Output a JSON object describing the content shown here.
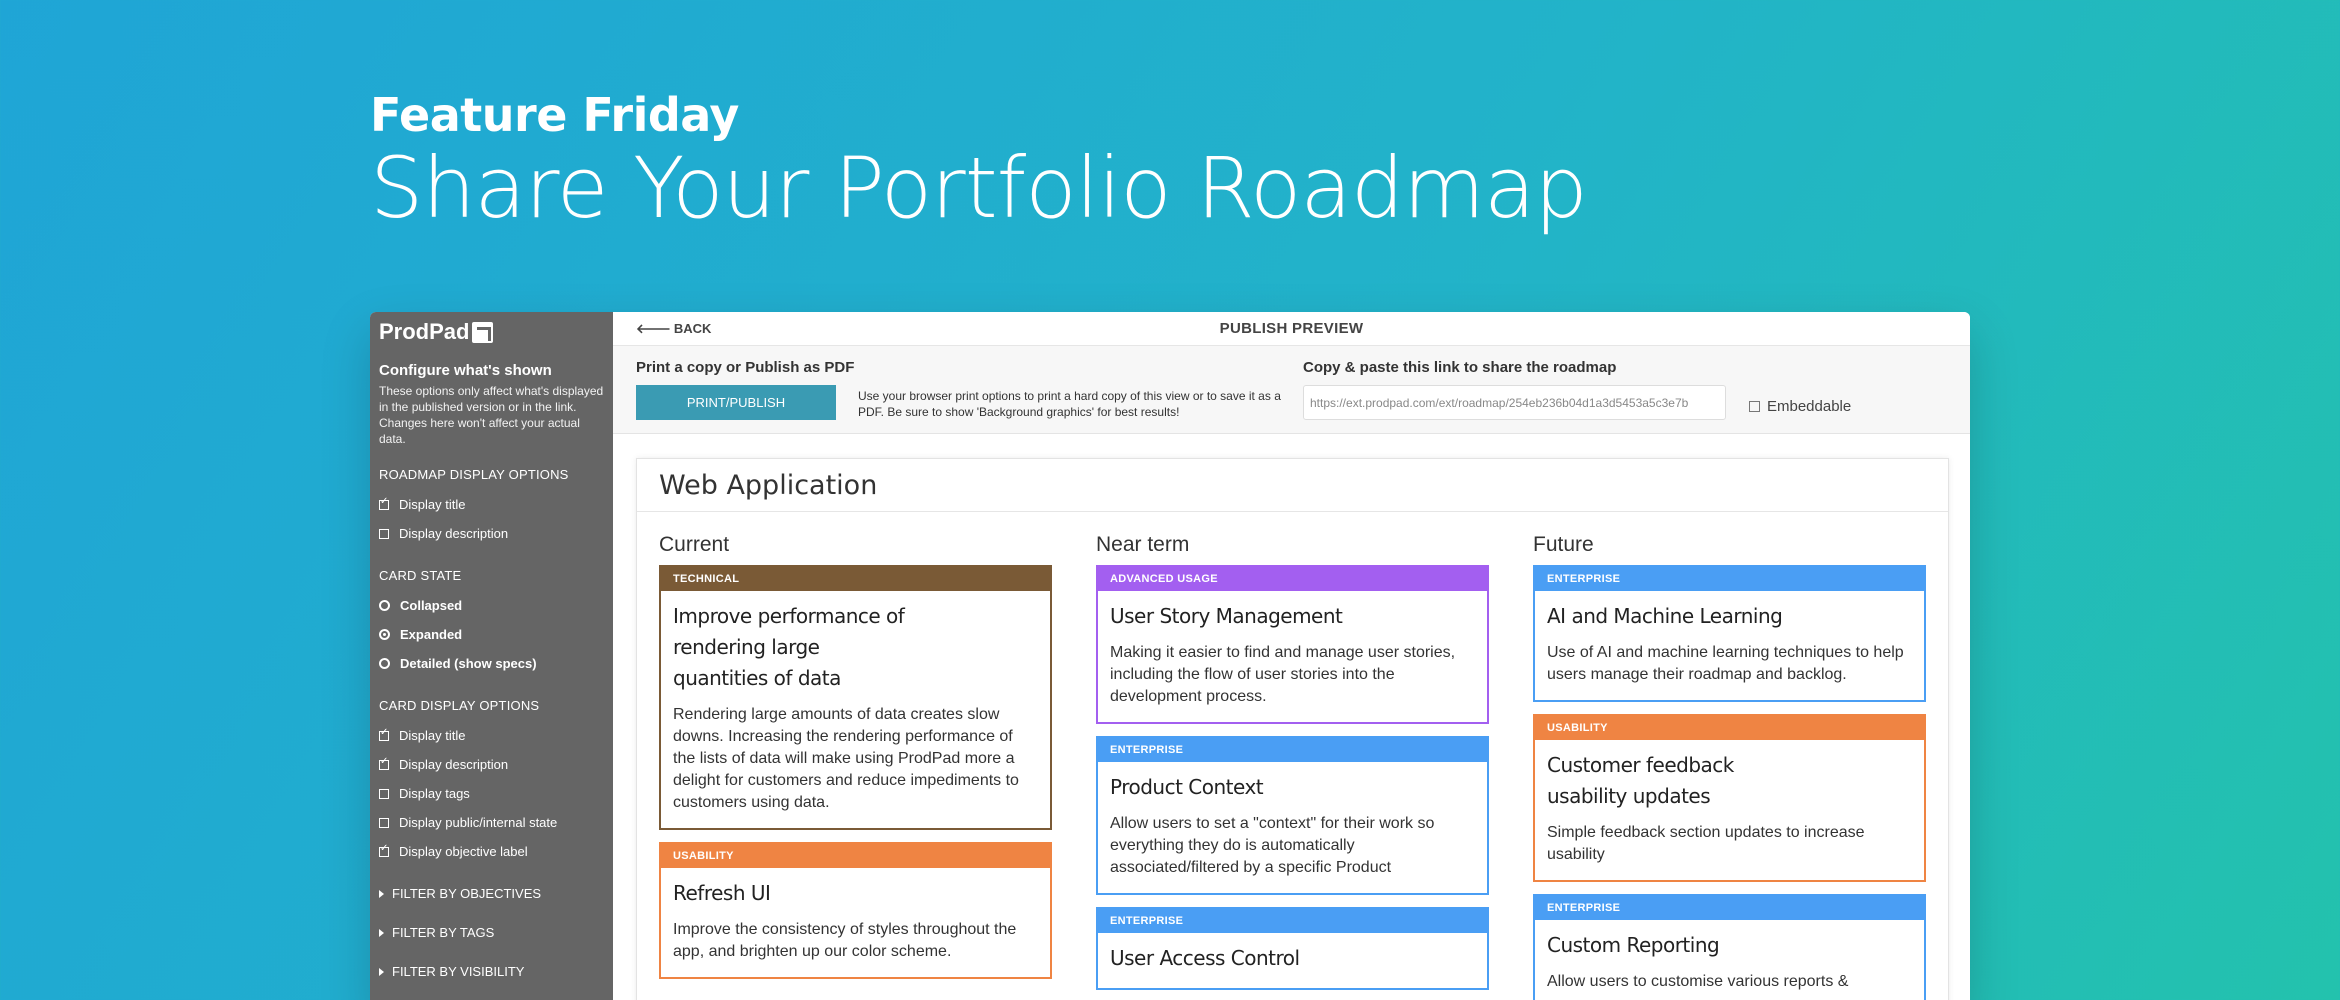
{
  "hero": {
    "subtitle": "Feature Friday",
    "title": "Share Your Portfolio Roadmap"
  },
  "sidebar": {
    "logo": "ProdPad",
    "configure_title": "Configure what's shown",
    "configure_desc": "These options only affect what's displayed in the published version or in the link. Changes here won't affect your actual data.",
    "roadmap_section": "ROADMAP DISPLAY OPTIONS",
    "roadmap_options": [
      {
        "label": "Display title",
        "checked": true
      },
      {
        "label": "Display description",
        "checked": false
      }
    ],
    "card_state_section": "CARD STATE",
    "card_states": [
      {
        "label": "Collapsed",
        "selected": false
      },
      {
        "label": "Expanded",
        "selected": true
      },
      {
        "label": "Detailed (show specs)",
        "selected": false
      }
    ],
    "card_display_section": "CARD DISPLAY OPTIONS",
    "card_display_options": [
      {
        "label": "Display title",
        "checked": true
      },
      {
        "label": "Display description",
        "checked": true
      },
      {
        "label": "Display tags",
        "checked": false
      },
      {
        "label": "Display public/internal state",
        "checked": false
      },
      {
        "label": "Display objective label",
        "checked": true
      }
    ],
    "filters": [
      "FILTER BY OBJECTIVES",
      "FILTER BY TAGS",
      "FILTER BY VISIBILITY"
    ]
  },
  "topbar": {
    "back_label": "BACK",
    "title": "PUBLISH PREVIEW"
  },
  "publish": {
    "print_heading": "Print a copy or Publish as PDF",
    "button_label": "PRINT/PUBLISH",
    "help_text": "Use your browser print options to print a hard copy of this view or to save it as a PDF. Be sure to show 'Background graphics' for best results!",
    "share_heading": "Copy & paste this link to share the roadmap",
    "share_url": "https://ext.prodpad.com/ext/roadmap/254eb236b04d1a3d5453a5c3e7b",
    "embeddable_label": "Embeddable",
    "embeddable_checked": false
  },
  "roadmap": {
    "title": "Web Application",
    "columns": [
      {
        "name": "Current",
        "cards": [
          {
            "tag": "TECHNICAL",
            "color": "#7a5a36",
            "title": "Improve performance of\nrendering large\nquantities of data",
            "desc": "Rendering large amounts of data creates slow downs. Increasing the rendering performance of the lists of data will make using ProdPad more a  delight for customers and reduce impediments to customers using data."
          },
          {
            "tag": "USABILITY",
            "color": "#ef8443",
            "title": "Refresh UI",
            "desc": "Improve the consistency of styles throughout the app, and brighten up our color scheme."
          }
        ]
      },
      {
        "name": "Near term",
        "cards": [
          {
            "tag": "ADVANCED USAGE",
            "color": "#a35ff0",
            "title": "User Story Management",
            "desc": "Making it easier to find and manage user stories, including the flow of user stories into the development process."
          },
          {
            "tag": "ENTERPRISE",
            "color": "#4a9ef4",
            "title": "Product Context",
            "desc": "Allow users to set a \"context\" for their work so everything they do is automatically associated/filtered by a specific Product"
          },
          {
            "tag": "ENTERPRISE",
            "color": "#4a9ef4",
            "title": "User Access Control",
            "desc": ""
          }
        ]
      },
      {
        "name": "Future",
        "cards": [
          {
            "tag": "ENTERPRISE",
            "color": "#4a9ef4",
            "title": "AI and Machine Learning",
            "desc": "Use of AI and machine learning techniques to help users manage their roadmap and backlog."
          },
          {
            "tag": "USABILITY",
            "color": "#ef8443",
            "title": "Customer feedback\nusability updates",
            "desc": "Simple feedback section updates to increase usability"
          },
          {
            "tag": "ENTERPRISE",
            "color": "#4a9ef4",
            "title": "Custom Reporting",
            "desc": "Allow users to customise various reports &"
          }
        ]
      }
    ]
  }
}
